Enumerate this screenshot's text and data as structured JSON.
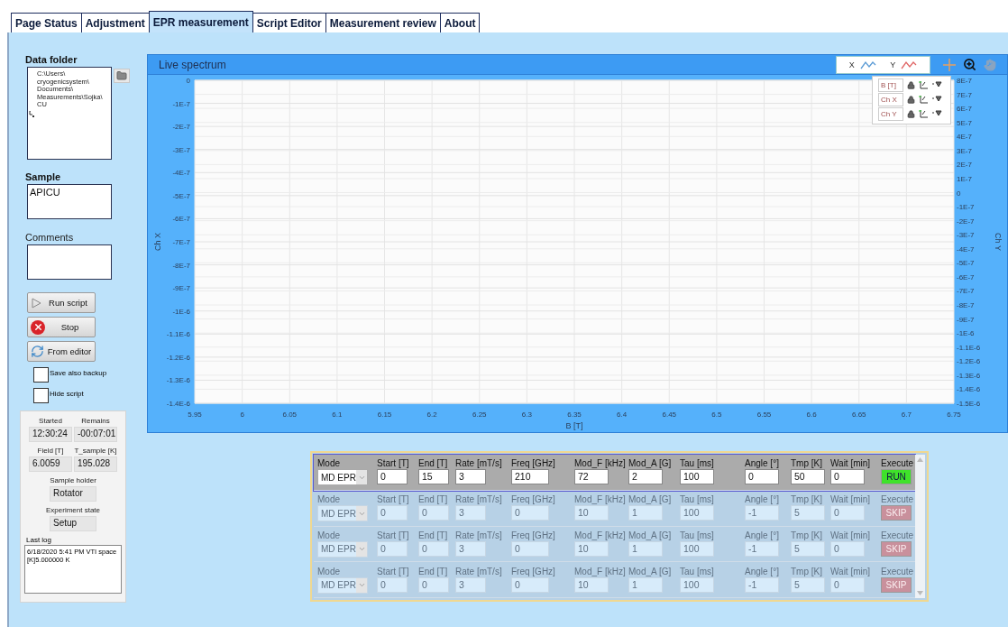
{
  "tabs": [
    {
      "label": "Page Status",
      "selected": false
    },
    {
      "label": "Adjustment",
      "selected": false
    },
    {
      "label": "EPR measurement",
      "selected": true
    },
    {
      "label": "Script Editor",
      "selected": false
    },
    {
      "label": "Measurement review",
      "selected": false
    },
    {
      "label": "About",
      "selected": false
    }
  ],
  "left_panel": {
    "data_folder": {
      "label": "Data folder",
      "lines": [
        "C:\\Users\\",
        "cryogenicsystem\\",
        "Documents\\",
        "Measurements\\Sojka\\",
        "CU"
      ]
    },
    "sample": {
      "label": "Sample",
      "value": "APICU"
    },
    "comments": {
      "label": "Comments"
    },
    "buttons": [
      {
        "label": "Run script",
        "kind": "run"
      },
      {
        "label": "Stop",
        "kind": "stop"
      },
      {
        "label": "From editor",
        "kind": "reload"
      }
    ],
    "checkboxes": [
      {
        "label": "Save also backup",
        "checked": false
      },
      {
        "label": "Hide script",
        "checked": false
      }
    ]
  },
  "status": {
    "pairs": [
      [
        {
          "label": "Started",
          "value": "12:30:24"
        },
        {
          "label": "Remains",
          "value": "-00:07:01"
        }
      ],
      [
        {
          "label": "Field [T]",
          "value": "6.0059"
        },
        {
          "label": "T_sample [K]",
          "value": "195.028"
        }
      ]
    ],
    "singles": [
      {
        "label": "Sample holder",
        "value": "Rotator"
      },
      {
        "label": "Experiment state",
        "value": "Setup"
      }
    ],
    "last_log": {
      "label": "Last log",
      "value": "6/18/2020 5:41 PM VTI space [K]5.000000 K"
    }
  },
  "chart_panel": {
    "title": "Live spectrum",
    "legend": [
      {
        "label": "X",
        "color": "#5b9bd5"
      },
      {
        "label": "Y",
        "color": "#e06666"
      }
    ],
    "scales": [
      {
        "name": "B [T]"
      },
      {
        "name": "Ch X"
      },
      {
        "name": "Ch Y"
      }
    ],
    "chart_data": {
      "type": "line",
      "grid": true,
      "xlabel": "B [T]",
      "ylabel": "Ch X",
      "xlim": [
        5.95,
        6.75
      ],
      "ylim": [
        -1.4e-06,
        0
      ],
      "xticks": [
        {
          "value": 5.95,
          "label": "5.95"
        },
        {
          "value": 6,
          "label": "6"
        },
        {
          "value": 6.05,
          "label": "6.05"
        },
        {
          "value": 6.1,
          "label": "6.1"
        },
        {
          "value": 6.15,
          "label": "6.15"
        },
        {
          "value": 6.2,
          "label": "6.2"
        },
        {
          "value": 6.25,
          "label": "6.25"
        },
        {
          "value": 6.3,
          "label": "6.3"
        },
        {
          "value": 6.35,
          "label": "6.35"
        },
        {
          "value": 6.4,
          "label": "6.4"
        },
        {
          "value": 6.45,
          "label": "6.45"
        },
        {
          "value": 6.5,
          "label": "6.5"
        },
        {
          "value": 6.55,
          "label": "6.55"
        },
        {
          "value": 6.6,
          "label": "6.6"
        },
        {
          "value": 6.65,
          "label": "6.65"
        },
        {
          "value": 6.7,
          "label": "6.7"
        },
        {
          "value": 6.75,
          "label": "6.75"
        }
      ],
      "yticks": [
        {
          "value": 0,
          "label": "0"
        },
        {
          "value": -1e-07,
          "label": "-1E-7"
        },
        {
          "value": -2e-07,
          "label": "-2E-7"
        },
        {
          "value": -3e-07,
          "label": "-3E-7"
        },
        {
          "value": -4e-07,
          "label": "-4E-7"
        },
        {
          "value": -5e-07,
          "label": "-5E-7"
        },
        {
          "value": -6e-07,
          "label": "-6E-7"
        },
        {
          "value": -7e-07,
          "label": "-7E-7"
        },
        {
          "value": -8e-07,
          "label": "-8E-7"
        },
        {
          "value": -9e-07,
          "label": "-9E-7"
        },
        {
          "value": -1e-06,
          "label": "-1E-6"
        },
        {
          "value": -1.1e-06,
          "label": "-1.1E-6"
        },
        {
          "value": -1.2e-06,
          "label": "-1.2E-6"
        },
        {
          "value": -1.3e-06,
          "label": "-1.3E-6"
        },
        {
          "value": -1.4e-06,
          "label": "-1.4E-6"
        }
      ]
    },
    "right_axis": {
      "label": "Ch Y",
      "ticks": [
        "8E-7",
        "7E-7",
        "6E-7",
        "5E-7",
        "4E-7",
        "3E-7",
        "2E-7",
        "1E-7",
        "0",
        "-1E-7",
        "-2E-7",
        "-3E-7",
        "-4E-7",
        "-5E-7",
        "-6E-7",
        "-7E-7",
        "-8E-7",
        "-9E-7",
        "-1E-6",
        "-1.1E-6",
        "-1.2E-6",
        "-1.3E-6",
        "-1.4E-6",
        "-1.5E-6"
      ]
    }
  },
  "steps": [
    {
      "active": true,
      "mode": {
        "label": "Mode",
        "value": "MD EPR"
      },
      "fields": [
        {
          "label": "Start [T]",
          "value": "0"
        },
        {
          "label": "End [T]",
          "value": "15"
        },
        {
          "label": "Rate [mT/s]",
          "value": "3"
        },
        {
          "label": "Freq [GHz]",
          "value": "210"
        },
        {
          "label": "Mod_F [kHz]",
          "value": "72"
        },
        {
          "label": "Mod_A [G]",
          "value": "2"
        },
        {
          "label": "Tau [ms]",
          "value": "100"
        },
        {
          "label": "Angle [°]",
          "value": "0"
        },
        {
          "label": "Tmp [K]",
          "value": "50"
        },
        {
          "label": "Wait [min]",
          "value": "0"
        }
      ],
      "execute": {
        "label": "Execute",
        "button": "RUN",
        "kind": "run"
      }
    },
    {
      "active": false,
      "mode": {
        "label": "Mode",
        "value": "MD EPR"
      },
      "fields": [
        {
          "label": "Start [T]",
          "value": "0"
        },
        {
          "label": "End [T]",
          "value": "0"
        },
        {
          "label": "Rate [mT/s]",
          "value": "3"
        },
        {
          "label": "Freq [GHz]",
          "value": "0"
        },
        {
          "label": "Mod_F [kHz]",
          "value": "10"
        },
        {
          "label": "Mod_A [G]",
          "value": "1"
        },
        {
          "label": "Tau [ms]",
          "value": "100"
        },
        {
          "label": "Angle [°]",
          "value": "-1"
        },
        {
          "label": "Tmp [K]",
          "value": "5"
        },
        {
          "label": "Wait [min]",
          "value": "0"
        }
      ],
      "execute": {
        "label": "Execute",
        "button": "SKIP",
        "kind": "skip"
      }
    },
    {
      "active": false,
      "mode": {
        "label": "Mode",
        "value": "MD EPR"
      },
      "fields": [
        {
          "label": "Start [T]",
          "value": "0"
        },
        {
          "label": "End [T]",
          "value": "0"
        },
        {
          "label": "Rate [mT/s]",
          "value": "3"
        },
        {
          "label": "Freq [GHz]",
          "value": "0"
        },
        {
          "label": "Mod_F [kHz]",
          "value": "10"
        },
        {
          "label": "Mod_A [G]",
          "value": "1"
        },
        {
          "label": "Tau [ms]",
          "value": "100"
        },
        {
          "label": "Angle [°]",
          "value": "-1"
        },
        {
          "label": "Tmp [K]",
          "value": "5"
        },
        {
          "label": "Wait [min]",
          "value": "0"
        }
      ],
      "execute": {
        "label": "Execute",
        "button": "SKIP",
        "kind": "skip"
      }
    },
    {
      "active": false,
      "mode": {
        "label": "Mode",
        "value": "MD EPR"
      },
      "fields": [
        {
          "label": "Start [T]",
          "value": "0"
        },
        {
          "label": "End [T]",
          "value": "0"
        },
        {
          "label": "Rate [mT/s]",
          "value": "3"
        },
        {
          "label": "Freq [GHz]",
          "value": "0"
        },
        {
          "label": "Mod_F [kHz]",
          "value": "10"
        },
        {
          "label": "Mod_A [G]",
          "value": "1"
        },
        {
          "label": "Tau [ms]",
          "value": "100"
        },
        {
          "label": "Angle [°]",
          "value": "-1"
        },
        {
          "label": "Tmp [K]",
          "value": "5"
        },
        {
          "label": "Wait [min]",
          "value": "0"
        }
      ],
      "execute": {
        "label": "Execute",
        "button": "SKIP",
        "kind": "skip"
      }
    }
  ]
}
